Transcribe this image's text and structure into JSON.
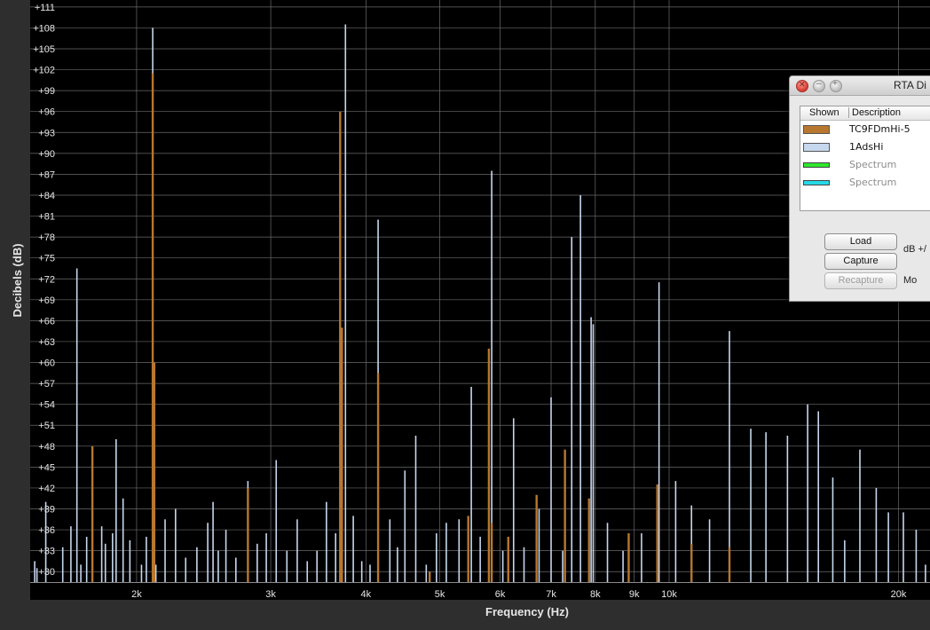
{
  "chart_data": {
    "type": "bar",
    "xlabel": "Frequency (Hz)",
    "ylabel": "Decibels (dB)",
    "x_scale": "log",
    "xlim": [
      1450,
      22000
    ],
    "ylim": [
      28.5,
      112
    ],
    "grid": true,
    "y_ticks": [
      "+30",
      "+33",
      "+36",
      "+39",
      "+42",
      "+45",
      "+48",
      "+51",
      "+54",
      "+57",
      "+60",
      "+63",
      "+66",
      "+69",
      "+72",
      "+75",
      "+78",
      "+81",
      "+84",
      "+87",
      "+90",
      "+93",
      "+96",
      "+99",
      "+102",
      "+105",
      "+108",
      "+111"
    ],
    "y_tick_values": [
      30,
      33,
      36,
      39,
      42,
      45,
      48,
      51,
      54,
      57,
      60,
      63,
      66,
      69,
      72,
      75,
      78,
      81,
      84,
      87,
      90,
      93,
      96,
      99,
      102,
      105,
      108,
      111
    ],
    "x_ticks": [
      {
        "label": "2k",
        "value": 2000
      },
      {
        "label": "3k",
        "value": 3000
      },
      {
        "label": "4k",
        "value": 4000
      },
      {
        "label": "5k",
        "value": 5000
      },
      {
        "label": "6k",
        "value": 6000
      },
      {
        "label": "7k",
        "value": 7000
      },
      {
        "label": "8k",
        "value": 8000
      },
      {
        "label": "9k",
        "value": 9000
      },
      {
        "label": "10k",
        "value": 10000
      },
      {
        "label": "20k",
        "value": 20000
      }
    ],
    "series": [
      {
        "name": "TC9FDmHi-5",
        "color": "#b8772f",
        "points": [
          [
            1750,
            48
          ],
          [
            2100,
            101.5
          ],
          [
            2110,
            60
          ],
          [
            2800,
            42
          ],
          [
            3700,
            96
          ],
          [
            3720,
            65
          ],
          [
            4150,
            58.5
          ],
          [
            4850,
            30
          ],
          [
            5450,
            38
          ],
          [
            5800,
            62
          ],
          [
            5850,
            37
          ],
          [
            6150,
            35
          ],
          [
            6700,
            41
          ],
          [
            7300,
            47.5
          ],
          [
            7850,
            40.5
          ],
          [
            8850,
            35.5
          ],
          [
            9650,
            42.5
          ],
          [
            10700,
            34
          ],
          [
            12000,
            33.5
          ]
        ]
      },
      {
        "name": "1AdsHi",
        "color": "#c6d7ee",
        "points": [
          [
            1470,
            31.5
          ],
          [
            1480,
            30.5
          ],
          [
            1520,
            40
          ],
          [
            1600,
            33.5
          ],
          [
            1640,
            36.5
          ],
          [
            1670,
            73.5
          ],
          [
            1690,
            31
          ],
          [
            1720,
            35
          ],
          [
            1800,
            36.5
          ],
          [
            1820,
            34
          ],
          [
            1860,
            35.5
          ],
          [
            1880,
            49
          ],
          [
            1920,
            40.5
          ],
          [
            1960,
            34.5
          ],
          [
            2030,
            31
          ],
          [
            2060,
            35
          ],
          [
            2100,
            108
          ],
          [
            2120,
            31
          ],
          [
            2180,
            37.5
          ],
          [
            2250,
            39
          ],
          [
            2320,
            32
          ],
          [
            2400,
            33.5
          ],
          [
            2480,
            37
          ],
          [
            2520,
            40
          ],
          [
            2560,
            33
          ],
          [
            2620,
            36
          ],
          [
            2700,
            32
          ],
          [
            2800,
            43
          ],
          [
            2880,
            34
          ],
          [
            2960,
            35.5
          ],
          [
            3050,
            46
          ],
          [
            3150,
            33
          ],
          [
            3250,
            37.5
          ],
          [
            3350,
            31.5
          ],
          [
            3450,
            33
          ],
          [
            3550,
            40
          ],
          [
            3650,
            35.5
          ],
          [
            3760,
            108.5
          ],
          [
            3850,
            38
          ],
          [
            3950,
            31.5
          ],
          [
            4050,
            31
          ],
          [
            4150,
            80.5
          ],
          [
            4300,
            37.5
          ],
          [
            4400,
            33.5
          ],
          [
            4500,
            44.5
          ],
          [
            4650,
            49.5
          ],
          [
            4800,
            31
          ],
          [
            4950,
            35.5
          ],
          [
            5100,
            37
          ],
          [
            5300,
            37.5
          ],
          [
            5500,
            56.5
          ],
          [
            5650,
            35
          ],
          [
            5850,
            87.5
          ],
          [
            6050,
            33
          ],
          [
            6250,
            52
          ],
          [
            6450,
            33.5
          ],
          [
            6750,
            39
          ],
          [
            7000,
            55
          ],
          [
            7250,
            33
          ],
          [
            7450,
            78
          ],
          [
            7650,
            84
          ],
          [
            7900,
            66.5
          ],
          [
            7950,
            65.5
          ],
          [
            8300,
            37
          ],
          [
            8700,
            33
          ],
          [
            9200,
            35.5
          ],
          [
            9700,
            71.5
          ],
          [
            10200,
            43
          ],
          [
            10700,
            39.5
          ],
          [
            11300,
            37.5
          ],
          [
            12000,
            64.5
          ],
          [
            12800,
            50.5
          ],
          [
            13400,
            50
          ],
          [
            14300,
            49.5
          ],
          [
            15200,
            54
          ],
          [
            15700,
            53
          ],
          [
            16400,
            43.5
          ],
          [
            17000,
            34.5
          ],
          [
            17800,
            47.5
          ],
          [
            18700,
            42
          ],
          [
            19400,
            38.5
          ],
          [
            20300,
            38.5
          ],
          [
            21100,
            36
          ],
          [
            21700,
            31
          ]
        ]
      }
    ]
  },
  "panel": {
    "title": "RTA Di",
    "col_shown": "Shown",
    "col_description": "Description",
    "rows": [
      {
        "label": "TC9FDmHi-5",
        "color": "#b8772f",
        "active": true
      },
      {
        "label": "1AdsHi",
        "color": "#c6d7ee",
        "active": true
      },
      {
        "label": "Spectrum",
        "color": "#2ee82e",
        "active": false
      },
      {
        "label": "Spectrum",
        "color": "#26d9e6",
        "active": false
      }
    ],
    "load_label": "Load",
    "capture_label": "Capture",
    "recapture_label": "Recapture",
    "db_label": "dB +/",
    "mode_label": "Mo"
  }
}
